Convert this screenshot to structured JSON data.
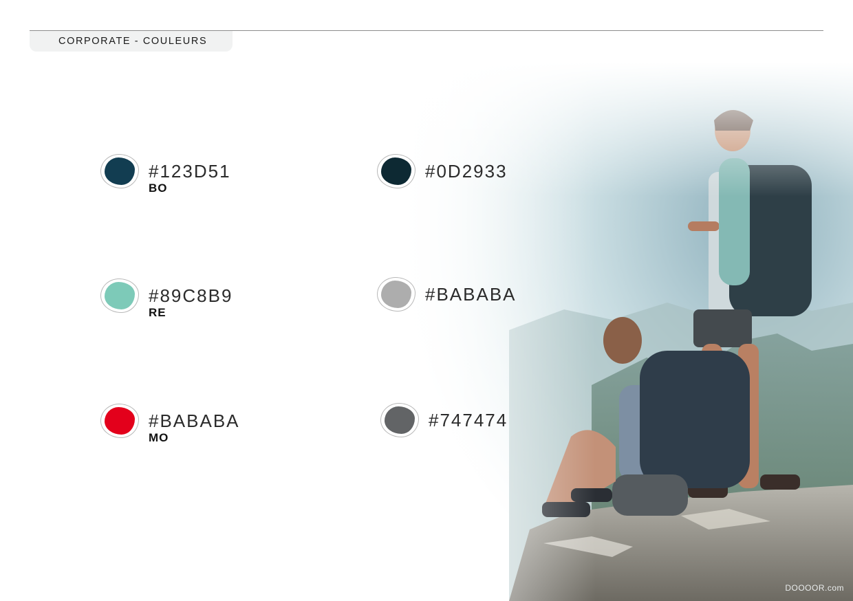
{
  "header": {
    "title": "CORPORATE - COULEURS"
  },
  "swatches": [
    {
      "hex": "#123D51",
      "label": "BO",
      "color": "#123D51"
    },
    {
      "hex": "#0D2933",
      "label": "",
      "color": "#0D2933"
    },
    {
      "hex": "#89C8B9",
      "label": "RE",
      "color": "#7DCAB8"
    },
    {
      "hex": "#BABABA",
      "label": "",
      "color": "#ADADAD"
    },
    {
      "hex": "#BABABA",
      "label": "MO",
      "color": "#E3001B"
    },
    {
      "hex": "#747474",
      "label": "",
      "color": "#626466"
    }
  ],
  "watermark": "DOOOOR.com"
}
